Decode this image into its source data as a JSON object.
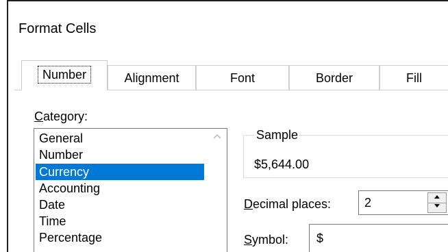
{
  "dialog": {
    "title": "Format Cells"
  },
  "tabs": [
    {
      "label": "Number",
      "selected": true
    },
    {
      "label": "Alignment",
      "selected": false
    },
    {
      "label": "Font",
      "selected": false
    },
    {
      "label": "Border",
      "selected": false
    },
    {
      "label": "Fill",
      "selected": false
    }
  ],
  "category": {
    "label_underlined_char": "C",
    "label_rest": "ategory:",
    "items": [
      {
        "label": "General",
        "selected": false
      },
      {
        "label": "Number",
        "selected": false
      },
      {
        "label": "Currency",
        "selected": true
      },
      {
        "label": "Accounting",
        "selected": false
      },
      {
        "label": "Date",
        "selected": false
      },
      {
        "label": "Time",
        "selected": false
      },
      {
        "label": "Percentage",
        "selected": false
      }
    ]
  },
  "sample": {
    "legend": "Sample",
    "value": "$5,644.00"
  },
  "decimal_places": {
    "label_underlined_char": "D",
    "label_rest": "ecimal places:",
    "value": "2"
  },
  "symbol": {
    "label_underlined_char": "S",
    "label_rest": "ymbol:",
    "value": "$"
  },
  "icons": {
    "scroll_up": "chevron-up-icon",
    "spin_up": "triangle-up-icon",
    "spin_down": "triangle-down-icon"
  },
  "colors": {
    "selection": "#0078d7",
    "selection_text": "#ffffff"
  }
}
